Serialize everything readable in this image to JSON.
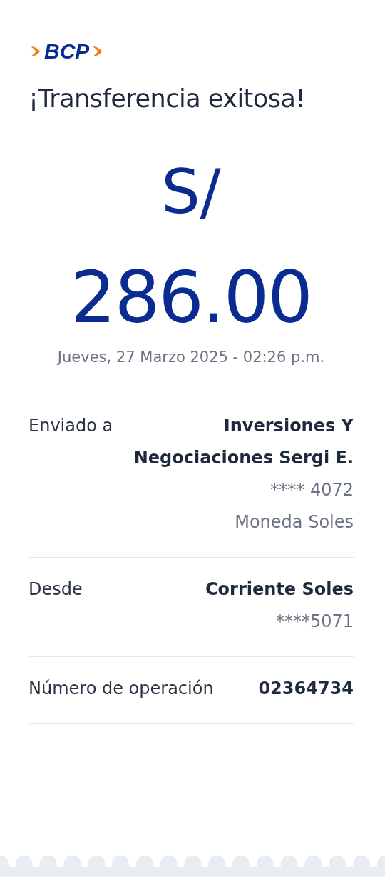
{
  "logo": {
    "text": "BCP"
  },
  "title": "¡Transferencia exitosa!",
  "amount": {
    "currency": "S/",
    "value": "286.00"
  },
  "date": "Jueves, 27 Marzo 2025 - 02:26 p.m.",
  "details": [
    {
      "label": "Enviado a",
      "lines": [
        {
          "text": "Inversiones Y",
          "bold": true
        },
        {
          "text": "Negociaciones Sergi E.",
          "bold": true
        },
        {
          "text": "**** 4072",
          "bold": false
        },
        {
          "text": "Moneda Soles",
          "bold": false
        }
      ]
    },
    {
      "label": "Desde",
      "lines": [
        {
          "text": "Corriente Soles",
          "bold": true
        },
        {
          "text": "****5071",
          "bold": false
        }
      ]
    },
    {
      "label": "Número de operación",
      "lines": [
        {
          "text": "02364734",
          "bold": true
        }
      ]
    }
  ]
}
